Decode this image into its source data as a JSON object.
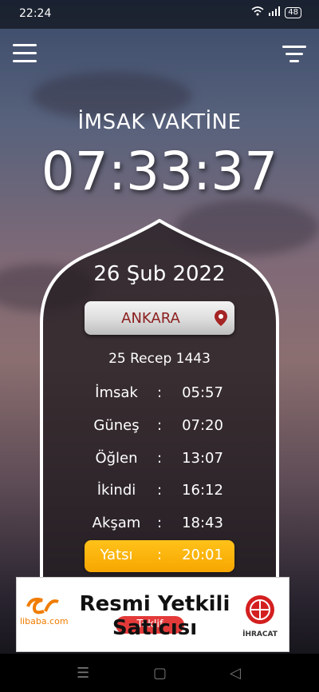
{
  "status_bar": {
    "time": "22:24",
    "battery": "48"
  },
  "header": {
    "title": "İMSAK VAKTİNE",
    "countdown": "07:33:37"
  },
  "card": {
    "date": "26 Şub 2022",
    "city": "ANKARA",
    "hijri_date": "25 Recep 1443",
    "separator": ":",
    "prayers": [
      {
        "name": "İmsak",
        "time": "05:57"
      },
      {
        "name": "Güneş",
        "time": "07:20"
      },
      {
        "name": "Öğlen",
        "time": "13:07"
      },
      {
        "name": "İkindi",
        "time": "16:12"
      },
      {
        "name": "Akşam",
        "time": "18:43"
      },
      {
        "name": "Yatsı",
        "time": "20:01"
      }
    ]
  },
  "ad": {
    "brand": "libaba.com",
    "title": "Resmi Yetkili Satıcısı",
    "cta": "Teklif",
    "partner": "İHRACAT"
  },
  "colors": {
    "accent": "#f7a600",
    "city_text": "#8b1e1e"
  },
  "icons": [
    "menu-icon",
    "filter-icon",
    "location-pin-icon",
    "wifi-icon",
    "signal-icon",
    "battery-icon"
  ]
}
